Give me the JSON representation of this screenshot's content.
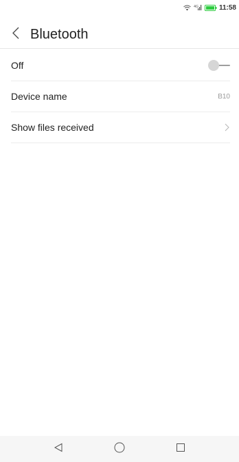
{
  "status_bar": {
    "time": "11:58",
    "icons": [
      "wifi-icon",
      "signal-icon",
      "battery-icon"
    ],
    "battery_color": "#2ecc40"
  },
  "header": {
    "title": "Bluetooth",
    "back_icon": "chevron-left-icon"
  },
  "settings": {
    "bluetooth_toggle": {
      "label": "Off",
      "state": "off"
    },
    "device_name": {
      "label": "Device name",
      "value": "B10"
    },
    "show_files": {
      "label": "Show files received",
      "icon": "chevron-right-icon"
    }
  },
  "nav_bar": {
    "buttons": [
      "back-triangle-icon",
      "home-circle-icon",
      "recents-square-icon"
    ]
  }
}
